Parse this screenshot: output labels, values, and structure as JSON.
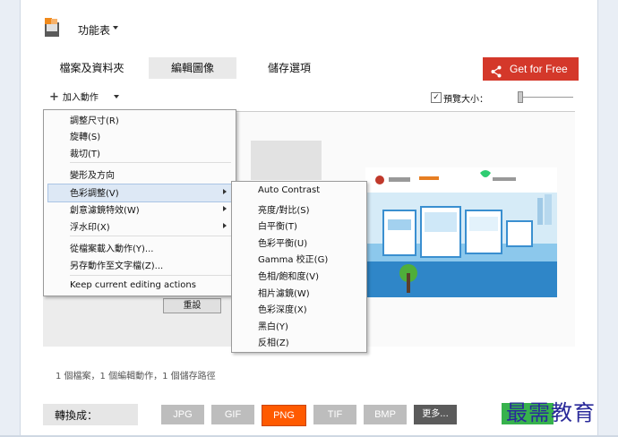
{
  "header": {
    "title": "功能表",
    "app_icon": "app-logo-icon"
  },
  "tabs": [
    {
      "label": "檔案及資料夾",
      "active": false
    },
    {
      "label": "編輯圖像",
      "active": true
    },
    {
      "label": "儲存選項",
      "active": false
    }
  ],
  "promo": {
    "label": "Get for Free",
    "icon": "share-icon",
    "color": "#d4382a"
  },
  "toolbar": {
    "add_action_label": "加入動作",
    "preview_size_label": "預覽大小：",
    "preview_checked": true
  },
  "context_menu": {
    "items": [
      {
        "label": "調整尺寸(R)"
      },
      {
        "label": "旋轉(S)"
      },
      {
        "label": "裁切(T)"
      },
      {
        "label": "變形及方向"
      },
      {
        "label": "色彩調整(V)",
        "submenu": true,
        "highlighted": true
      },
      {
        "label": "創意濾鏡特效(W)",
        "submenu": true
      },
      {
        "label": "浮水印(X)",
        "submenu": true
      },
      {
        "label": "從檔案載入動作(Y)..."
      },
      {
        "label": "另存動作至文字檔(Z)..."
      },
      {
        "label": "Keep current editing actions"
      }
    ]
  },
  "submenu": {
    "items": [
      {
        "label": "Auto Contrast"
      },
      {
        "label": "亮度/對比(S)"
      },
      {
        "label": "白平衡(T)"
      },
      {
        "label": "色彩平衡(U)"
      },
      {
        "label": "Gamma 校正(G)"
      },
      {
        "label": "色相/飽和度(V)"
      },
      {
        "label": "相片濾鏡(W)"
      },
      {
        "label": "色彩深度(X)"
      },
      {
        "label": "黑白(Y)"
      },
      {
        "label": "反相(Z)"
      }
    ]
  },
  "editor": {
    "reset_label": "重設"
  },
  "status_text": "1 個檔案，1 個編輯動作，1 個儲存路徑",
  "convert": {
    "label": "轉換成：",
    "formats": [
      {
        "label": "JPG",
        "selected": false
      },
      {
        "label": "GIF",
        "selected": false
      },
      {
        "label": "PNG",
        "selected": true
      },
      {
        "label": "TIF",
        "selected": false
      },
      {
        "label": "BMP",
        "selected": false
      }
    ],
    "more_label": "更多...",
    "accent_color": "#ff5a00"
  },
  "watermark_text": "最需教育"
}
